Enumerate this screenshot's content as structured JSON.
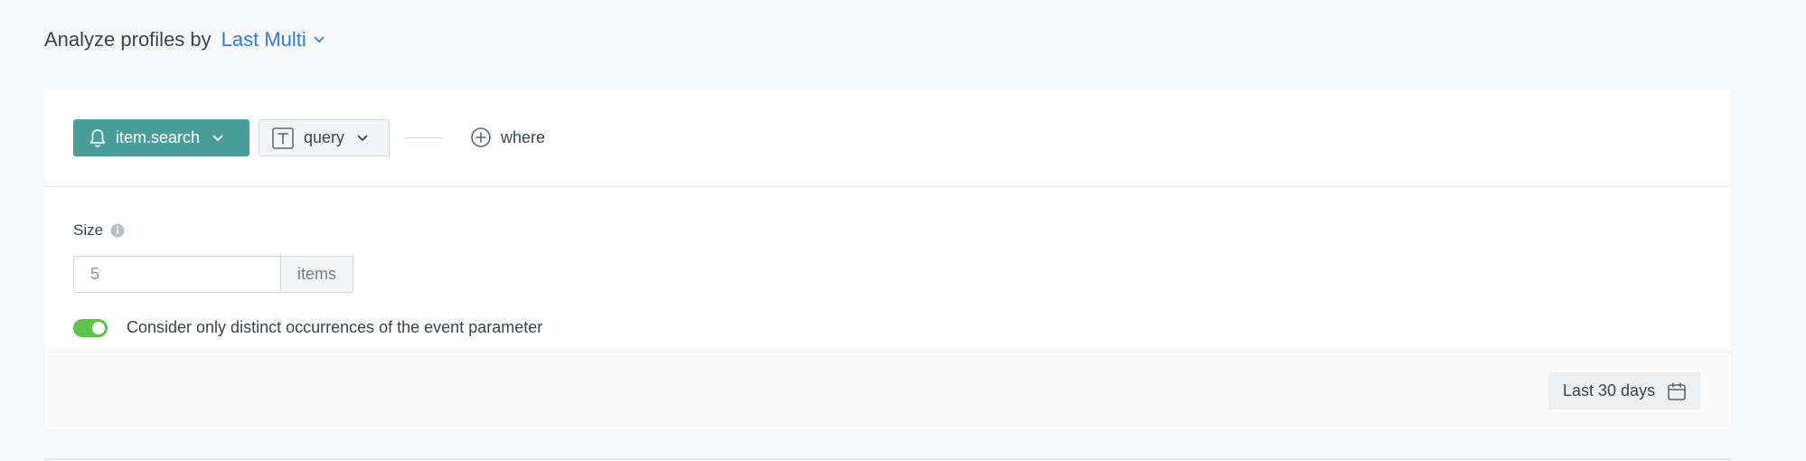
{
  "header": {
    "title": "Analyze profiles by",
    "selector_label": "Last Multi"
  },
  "filter": {
    "event_label": "item.search",
    "event_icon": "bell-icon",
    "param_label": "query",
    "param_icon": "text-type-icon",
    "where_label": "where"
  },
  "size": {
    "label": "Size",
    "value": "5",
    "unit": "items"
  },
  "distinct": {
    "label": "Consider only distinct occurrences of the event parameter",
    "enabled": true
  },
  "footer": {
    "date_range_label": "Last 30 days"
  },
  "colors": {
    "accent": "#2f7ae5",
    "event_button": "#4a9e9a",
    "toggle_on": "#5cc447"
  }
}
